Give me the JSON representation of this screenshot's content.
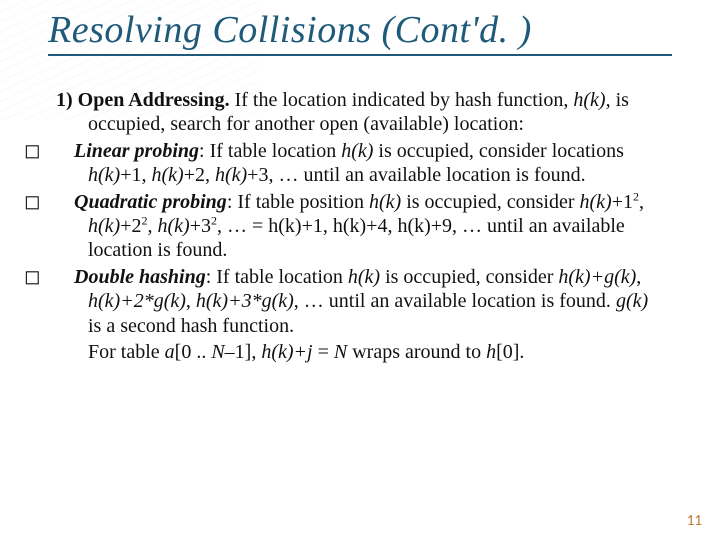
{
  "title": "Resolving Collisions (Cont'd. )",
  "intro_label": "1) Open Addressing.",
  "intro_rest": "  If the location indicated by hash function, <i>h(k)</i>, is occupied, search for another open (available) location:",
  "linear_label": "Linear probing",
  "linear_rest": ":  If table location <i>h(k)</i> is occupied, consider locations <i>h(k)</i>+1,  <i>h(k)</i>+2,  <i>h(k)</i>+3, … until an available location is found.",
  "quad_label": "Quadratic probing",
  "quad_rest": ":  If table position <i>h(k)</i> is occupied, consider <i>h(k)</i>+1<span class='sup'>2</span>,  <i>h(k)</i>+2<span class='sup'>2</span>,  <i>h(k)</i>+3<span class='sup'>2</span>, …  =  h(k)+1, h(k)+4, h(k)+9, … until an available location is found.",
  "double_label": "Double hashing",
  "double_rest": ":  If table location <i>h(k)</i> is occupied, consider <i>h(k)+g(k)</i>,  <i>h(k)+2*g(k)</i>,  <i>h(k)+3*g(k)</i>, … until an available location is found.  <i>g(k)</i> is a second hash function.",
  "wrap_line": "For table <i>a</i>[0 .. <i>N</i>–1],  <i>h(k)+j</i> = <i>N</i>  wraps around to <i>h</i>[0].",
  "page_number": "11",
  "bullet_glyph": "◻"
}
